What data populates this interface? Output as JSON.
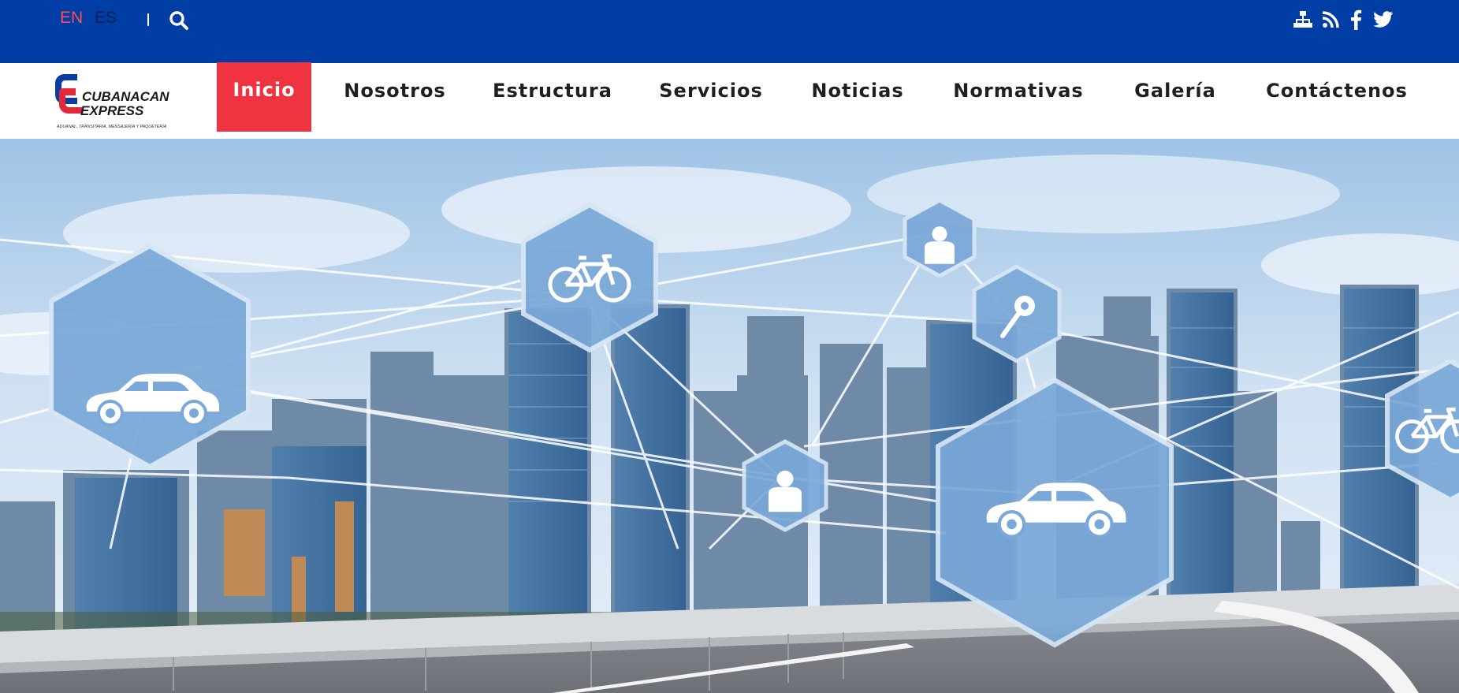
{
  "topbar": {
    "lang_en": "EN",
    "lang_es": "ES",
    "search_icon": "search-icon",
    "social_icons": [
      "sitemap-icon",
      "rss-icon",
      "facebook-icon",
      "twitter-icon"
    ],
    "colors": {
      "background": "#003da5",
      "active_lang": "#ff4d5a"
    }
  },
  "navbar": {
    "logo": {
      "name": "CUBANACAN",
      "sub": "EXPRESS",
      "tagline": "ADUANAL, TRANSITARIA, MENSAJERÍA Y PAQUETERÍA"
    },
    "items": [
      {
        "label": "Inicio",
        "active": true
      },
      {
        "label": "Nosotros"
      },
      {
        "label": "Estructura"
      },
      {
        "label": "Servicios"
      },
      {
        "label": "Noticias"
      },
      {
        "label": "Normativas"
      },
      {
        "label": "Galería"
      },
      {
        "label": "Contáctenos"
      }
    ],
    "colors": {
      "active_bg": "#ef3340"
    }
  },
  "hero": {
    "icons": [
      "car-icon",
      "bicycle-icon",
      "person-icon",
      "key-icon",
      "car-icon",
      "person-icon",
      "bicycle-icon"
    ]
  }
}
